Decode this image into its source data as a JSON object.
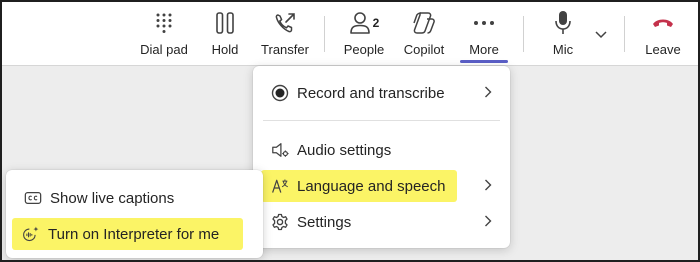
{
  "toolbar": {
    "dialpad": "Dial pad",
    "hold": "Hold",
    "transfer": "Transfer",
    "people": "People",
    "people_count": "2",
    "copilot": "Copilot",
    "more": "More",
    "mic": "Mic",
    "leave": "Leave"
  },
  "more_menu": {
    "record": "Record and transcribe",
    "audio": "Audio settings",
    "language": "Language and speech",
    "settings": "Settings"
  },
  "language_submenu": {
    "captions": "Show live captions",
    "interpreter": "Turn on Interpreter for me"
  },
  "colors": {
    "accent": "#5b5fc7",
    "leave_red": "#c4314b",
    "highlight": "#fbf466"
  }
}
